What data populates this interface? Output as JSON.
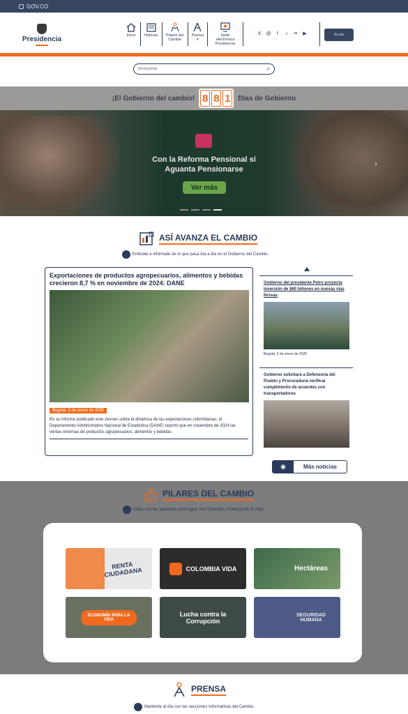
{
  "gov_bar": {
    "label": "GOV.CO"
  },
  "header": {
    "logo_name": "Presidencia",
    "nav": [
      {
        "label": "Inicio",
        "icon": "home-icon"
      },
      {
        "label": "Noticias",
        "icon": "newspaper-icon"
      },
      {
        "label": "Pilares del Cambio",
        "icon": "people-icon"
      },
      {
        "label": "Prensa",
        "icon": "press-icon"
      },
      {
        "label": "Sede electrónica Presidencia",
        "icon": "screen-icon"
      }
    ],
    "social": [
      "X",
      "@",
      "f",
      "♪",
      "••",
      "▶"
    ],
    "lang_button": "Ayuda"
  },
  "search": {
    "placeholder": "Búsqueda"
  },
  "counter": {
    "left_text": "¡El Gobierno del cambio!",
    "digits": [
      "8",
      "8",
      "1"
    ],
    "right_text": "Días de Gobierno"
  },
  "hero": {
    "title": "Con la Reforma Pensional sí Aguanta Pensionarse",
    "button": "Ver más"
  },
  "asi_avanza": {
    "title": "ASÍ AVANZA EL CAMBIO",
    "subtitle": "Entérate e infórmate de lo que pasa día a día en el Gobierno del Cambio.",
    "main_news": {
      "title": "Exportaciones de productos agropecuarios, alimentos y bebidas crecieron 8,7 % en noviembre de 2024: DANE",
      "date": "Bogotá, 3 de enero de 2025",
      "description": "En su informe publicado este viernes sobre la dinámica de las exportaciones colombianas, el Departamento Administrativo Nacional de Estadística (DANE) reportó que en noviembre de 2024 las ventas externas de productos agropecuarios, alimentos y bebidas"
    },
    "side_news": [
      {
        "title": "Gobierno del presidente Petro proyecta inversión de $60 billones en nuevas vías férreas",
        "date": "Bogotá, 3 de enero de 2025"
      },
      {
        "title": "Gobierno solicitará a Defensoría del Pueblo y Procuraduría verificar cumplimiento de acuerdos con transportadores",
        "date": ""
      }
    ],
    "more_button": "Más noticias"
  },
  "pilares": {
    "title": "PILARES DEL CAMBIO",
    "subtitle": "Estas son las apuestas para lograr una Colombia, Potencia de la Vida.",
    "tiles": [
      {
        "label": "RENTA CIUDADANA"
      },
      {
        "label": "COLOMBIA VIDA"
      },
      {
        "label": "Hectáreas"
      },
      {
        "label": "ECONOMÍA PARA LA VIDA"
      },
      {
        "label": "Lucha contra la Corrupción"
      },
      {
        "label": "SEGURIDAD HUMANA"
      }
    ]
  },
  "prensa": {
    "title": "PRENSA",
    "subtitle": "Mantente al día con las secciones informativas del Cambio."
  }
}
